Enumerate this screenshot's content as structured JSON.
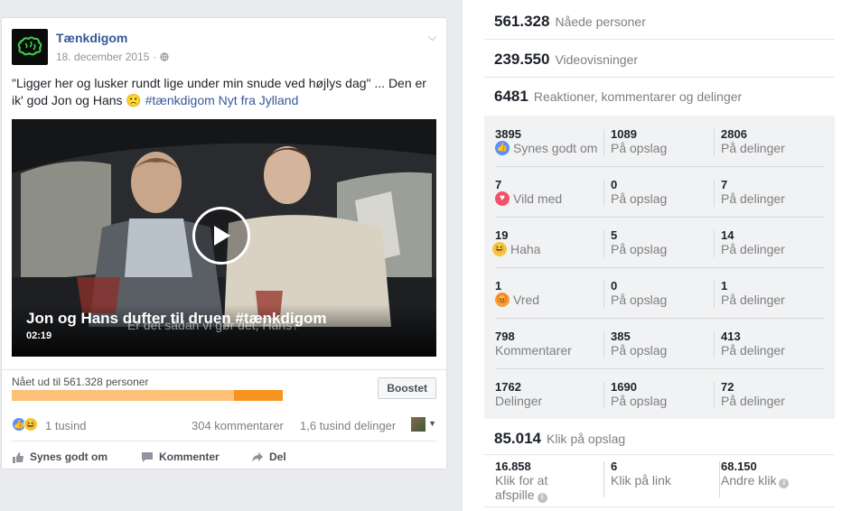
{
  "post": {
    "page_name": "Tænkdigom",
    "date": "18. december 2015",
    "text_main": "\"Ligger her og lusker rundt lige under min snude ved højlys dag\" ... Den er ik' god Jon og Hans 🙁 ",
    "hashtag": "#tænkdigom",
    "tag_tail": " Nyt fra Jylland",
    "video": {
      "title": "Jon og Hans dufter til druen #tænkdigom",
      "subtitle": "Er det sådan vi gør det, Hans?",
      "duration": "02:19"
    },
    "reach_label": "Nået ud til 561.328 personer",
    "reach": {
      "organic_fraction": 0.82,
      "paid_fraction": 0.18
    },
    "boost_label": "Boostet",
    "reactions_count": "1 tusind",
    "comments_count": "304 kommentarer",
    "shares_count": "1,6 tusind delinger",
    "actions": {
      "like": "Synes godt om",
      "comment": "Kommenter",
      "share": "Del"
    }
  },
  "insights": {
    "reach": {
      "num": "561.328",
      "label": "Nåede personer"
    },
    "views": {
      "num": "239.550",
      "label": "Videovisninger"
    },
    "engagement": {
      "num": "6481",
      "label": "Reaktioner, kommentarer og delinger"
    },
    "rows": [
      {
        "total": "3895",
        "label": "Synes godt om",
        "icon": "like-icon",
        "on_post": "1089",
        "on_shares": "2806"
      },
      {
        "total": "7",
        "label": "Vild med",
        "icon": "love-icon",
        "on_post": "0",
        "on_shares": "7"
      },
      {
        "total": "19",
        "label": "Haha",
        "icon": "haha-icon",
        "on_post": "5",
        "on_shares": "14"
      },
      {
        "total": "1",
        "label": "Vred",
        "icon": "angry-icon",
        "on_post": "0",
        "on_shares": "1"
      },
      {
        "total": "798",
        "label": "Kommentarer",
        "icon": "",
        "on_post": "385",
        "on_shares": "413"
      },
      {
        "total": "1762",
        "label": "Delinger",
        "icon": "",
        "on_post": "1690",
        "on_shares": "72"
      }
    ],
    "on_post_label": "På opslag",
    "on_shares_label": "På delinger",
    "clicks": {
      "num": "85.014",
      "label": "Klik på opslag"
    },
    "click_breakdown": [
      {
        "num": "16.858",
        "label": "Klik for at afspille"
      },
      {
        "num": "6",
        "label": "Klik på link"
      },
      {
        "num": "68.150",
        "label": "Andre klik"
      }
    ]
  },
  "colors": {
    "link": "#365899",
    "like": "#5890ff",
    "love": "#f25268",
    "reaction_yellow": "#f8c53d",
    "reach_bar": "#f7931e"
  }
}
